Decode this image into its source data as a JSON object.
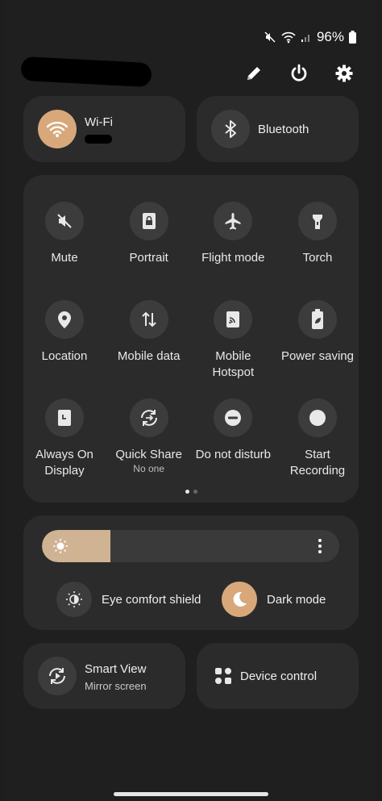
{
  "status": {
    "battery": "96%"
  },
  "header": {
    "edit_icon": "pencil-icon",
    "power_icon": "power-icon",
    "settings_icon": "gear-icon"
  },
  "wifi": {
    "label": "Wi-Fi",
    "active": true,
    "accent": "#d8a87a"
  },
  "bluetooth": {
    "label": "Bluetooth",
    "active": false
  },
  "tiles": [
    {
      "label": "Mute",
      "icon": "mute-icon"
    },
    {
      "label": "Portrait",
      "icon": "portrait-lock-icon"
    },
    {
      "label": "Flight mode",
      "icon": "airplane-icon"
    },
    {
      "label": "Torch",
      "icon": "torch-icon"
    },
    {
      "label": "Location",
      "icon": "location-pin-icon"
    },
    {
      "label": "Mobile data",
      "icon": "data-arrows-icon"
    },
    {
      "label": "Mobile Hotspot",
      "icon": "hotspot-icon"
    },
    {
      "label": "Power saving",
      "icon": "battery-leaf-icon"
    },
    {
      "label": "Always On Display",
      "icon": "aod-clock-icon"
    },
    {
      "label": "Quick Share",
      "sub": "No one",
      "icon": "quick-share-icon"
    },
    {
      "label": "Do not disturb",
      "icon": "dnd-icon"
    },
    {
      "label": "Start Recording",
      "icon": "record-icon"
    }
  ],
  "pager": {
    "pages": 2,
    "current": 1
  },
  "brightness": {
    "level": 0.23,
    "fill_color": "#cfb393"
  },
  "eye_comfort": {
    "label": "Eye comfort shield",
    "active": false
  },
  "dark_mode": {
    "label": "Dark mode",
    "active": true,
    "accent": "#d8a87a"
  },
  "smart_view": {
    "label": "Smart View",
    "sub": "Mirror screen"
  },
  "device_control": {
    "label": "Device control"
  }
}
